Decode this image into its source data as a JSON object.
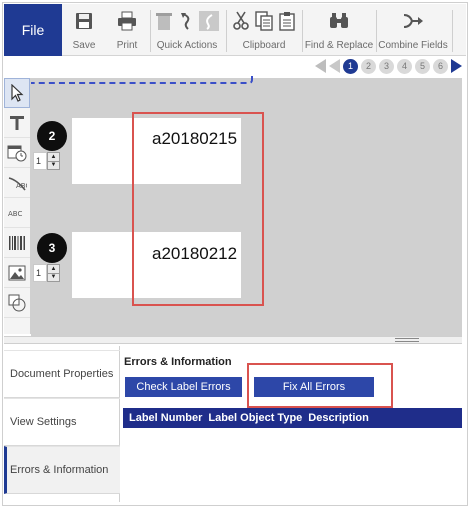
{
  "ribbon": {
    "file_label": "File",
    "save_label": "Save",
    "print_label": "Print",
    "quick_actions_label": "Quick Actions",
    "clipboard_label": "Clipboard",
    "find_replace_label": "Find & Replace",
    "combine_fields_label": "Combine Fields"
  },
  "pager": {
    "pages": [
      "1",
      "2",
      "3",
      "4",
      "5",
      "6"
    ],
    "current_page": "1"
  },
  "labels": [
    {
      "number": "2",
      "quantity": "1",
      "text": "a20180215"
    },
    {
      "number": "3",
      "quantity": "1",
      "text": "a20180212"
    }
  ],
  "tabs": {
    "document_properties": "Document Properties",
    "view_settings": "View Settings",
    "errors_information": "Errors & Information"
  },
  "errors_panel": {
    "title": "Errors & Information",
    "check_button": "Check Label Errors",
    "fix_button": "Fix All Errors",
    "columns": [
      "Label Number",
      "Label Object Type",
      "Description"
    ]
  },
  "colors": {
    "accent": "#1f3a93",
    "button": "#2d47a8",
    "table_header": "#1f2d8a",
    "highlight": "#d9534f"
  }
}
